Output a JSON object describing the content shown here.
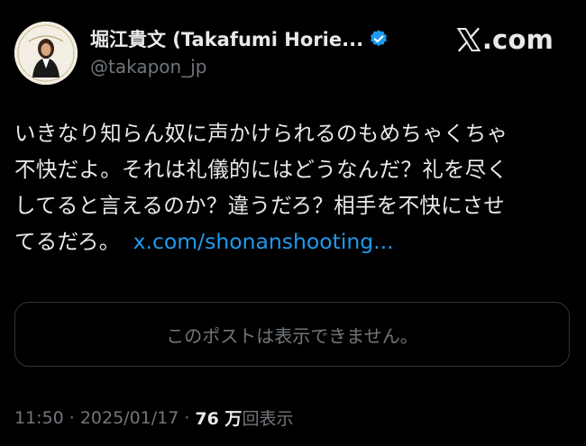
{
  "author": {
    "display_name": "堀江貴文 (Takafumi Horie...",
    "handle": "@takapon_jp",
    "verified_icon": "verified-badge-icon",
    "avatar_icon": "avatar-photo"
  },
  "brand": {
    "logo_icon": "x-logo-icon",
    "text": ".com"
  },
  "post": {
    "lines": [
      "いきなり知らん奴に声かけられるのもめちゃくちゃ",
      "不快だよ。それは礼儀的にはどうなんだ？礼を尽く",
      "してると言えるのか？違うだろ？相手を不快にさせ",
      "てるだろ。"
    ],
    "link": "x.com/shonanshooting..."
  },
  "quote": {
    "unavailable_text": "このポストは表示できません。"
  },
  "meta": {
    "time": "11:50",
    "separator": "·",
    "date": "2025/01/17",
    "views_count": "76 万",
    "views_label": "回表示"
  },
  "colors": {
    "background": "#000000",
    "text": "#e7e9ea",
    "secondary": "#71767b",
    "link": "#1d9bf0",
    "border": "#2f3336",
    "verified": "#1d9bf0"
  }
}
